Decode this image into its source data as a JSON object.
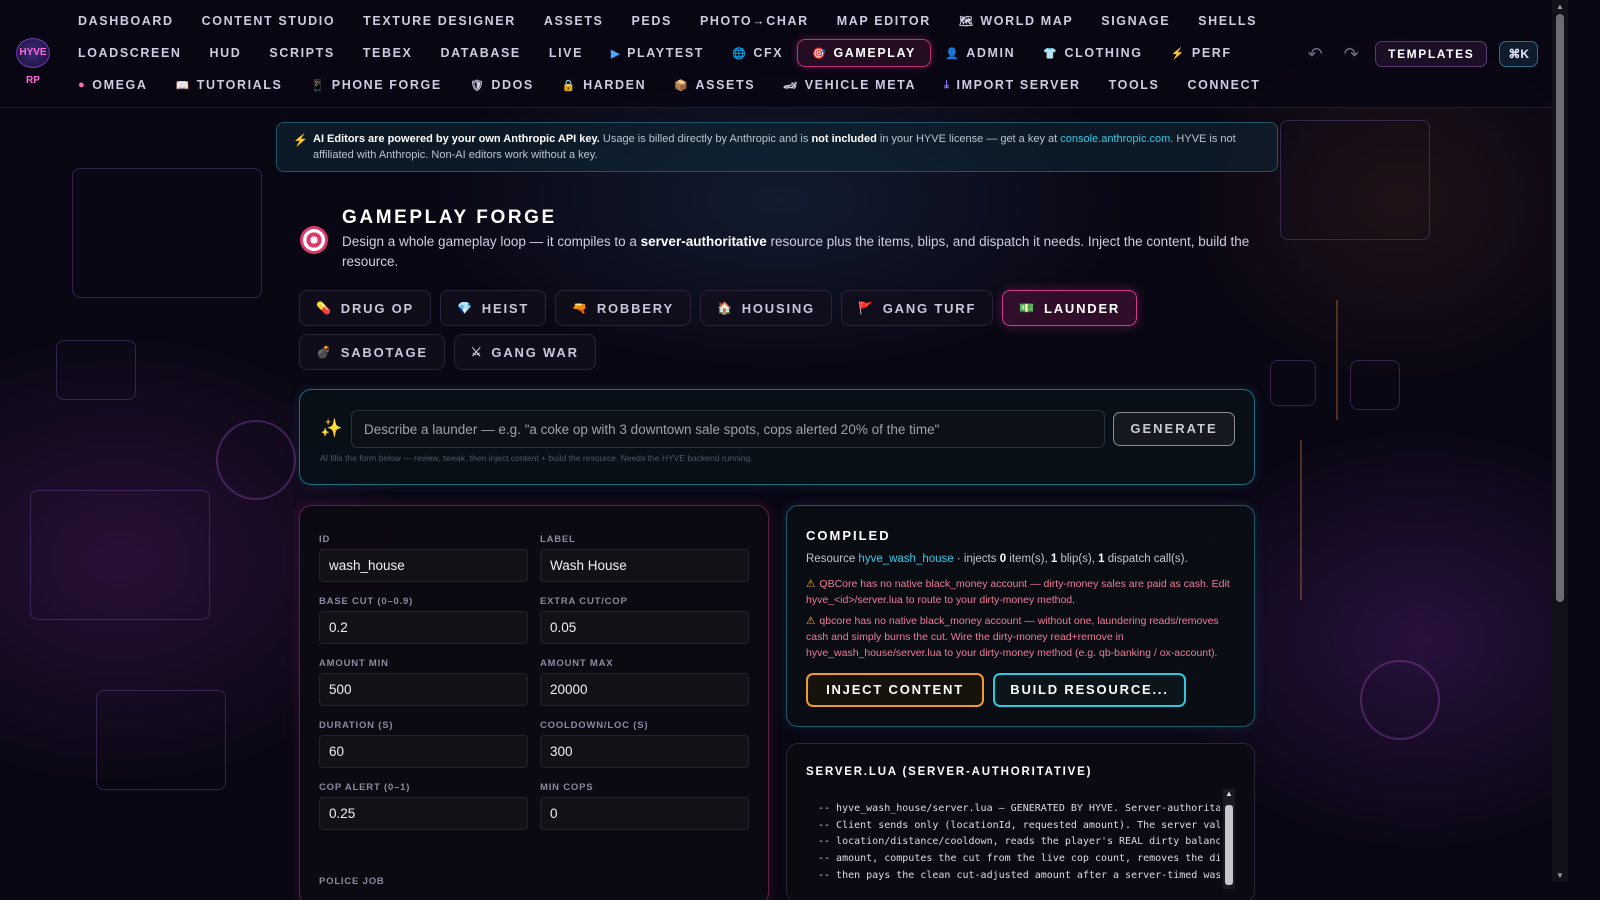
{
  "app": {
    "logo_text": "HYVE RP"
  },
  "nav": {
    "row1": [
      {
        "label": "DASHBOARD",
        "icon": ""
      },
      {
        "label": "CONTENT STUDIO",
        "icon": ""
      },
      {
        "label": "TEXTURE DESIGNER",
        "icon": ""
      },
      {
        "label": "ASSETS",
        "icon": ""
      },
      {
        "label": "PEDS",
        "icon": ""
      },
      {
        "label": "PHOTO→CHAR",
        "icon": ""
      },
      {
        "label": "MAP EDITOR",
        "icon": ""
      },
      {
        "label": "WORLD MAP",
        "icon": "🗺"
      },
      {
        "label": "SIGNAGE",
        "icon": ""
      },
      {
        "label": "SHELLS",
        "icon": ""
      }
    ],
    "row2": [
      {
        "label": "LOADSCREEN",
        "icon": ""
      },
      {
        "label": "HUD",
        "icon": ""
      },
      {
        "label": "SCRIPTS",
        "icon": ""
      },
      {
        "label": "TEBEX",
        "icon": ""
      },
      {
        "label": "DATABASE",
        "icon": ""
      },
      {
        "label": "LIVE",
        "icon": ""
      },
      {
        "label": "PLAYTEST",
        "icon": "▶"
      },
      {
        "label": "CFX",
        "icon": "🌐"
      },
      {
        "label": "GAMEPLAY",
        "icon": "🎯",
        "active": true
      },
      {
        "label": "ADMIN",
        "icon": "👤"
      },
      {
        "label": "CLOTHING",
        "icon": "👕"
      },
      {
        "label": "PERF",
        "icon": "⚡"
      }
    ],
    "row3": [
      {
        "label": "OMEGA",
        "icon": "●"
      },
      {
        "label": "TUTORIALS",
        "icon": "📖"
      },
      {
        "label": "PHONE FORGE",
        "icon": "📱"
      },
      {
        "label": "DDOS",
        "icon": "🛡"
      },
      {
        "label": "HARDEN",
        "icon": "🔒"
      },
      {
        "label": "ASSETS",
        "icon": "📦"
      },
      {
        "label": "VEHICLE META",
        "icon": "🏎"
      },
      {
        "label": "IMPORT SERVER",
        "icon": "⤓"
      },
      {
        "label": "TOOLS",
        "icon": ""
      },
      {
        "label": "CONNECT",
        "icon": ""
      }
    ],
    "undo_icon": "↶",
    "redo_icon": "↷",
    "templates_label": "TEMPLATES",
    "cmdk_label": "⌘K"
  },
  "notice": {
    "bold_lead": "AI Editors are powered by your own Anthropic API key.",
    "text1": " Usage is billed directly by Anthropic and is ",
    "bold_mid": "not included",
    "text2": " in your HYVE license — get a key at ",
    "link": "console.anthropic.com",
    "text3": ". HYVE is not affiliated with Anthropic. Non-AI editors work without a key."
  },
  "header": {
    "title": "GAMEPLAY FORGE",
    "desc_1": "Design a whole gameplay loop — it compiles to a ",
    "desc_bold": "server-authoritative",
    "desc_2": " resource plus the items, blips, and dispatch it needs. Inject the content, build the resource."
  },
  "tabs": [
    {
      "label": "DRUG OP",
      "icon": "💊"
    },
    {
      "label": "HEIST",
      "icon": "💎"
    },
    {
      "label": "ROBBERY",
      "icon": "🔫"
    },
    {
      "label": "HOUSING",
      "icon": "🏠"
    },
    {
      "label": "GANG TURF",
      "icon": "🚩"
    },
    {
      "label": "LAUNDER",
      "icon": "💵",
      "active": true
    },
    {
      "label": "SABOTAGE",
      "icon": "💣"
    },
    {
      "label": "GANG WAR",
      "icon": "⚔"
    }
  ],
  "ai": {
    "icon": "✨",
    "placeholder": "Describe a launder — e.g. \"a coke op with 3 downtown sale spots, cops alerted 20% of the time\"",
    "generate_label": "GENERATE",
    "hint": "AI fills the form below — review, tweak, then inject content + build the resource. Needs the HYVE backend running."
  },
  "form": {
    "fields": [
      {
        "label": "ID",
        "value": "wash_house"
      },
      {
        "label": "LABEL",
        "value": "Wash House"
      },
      {
        "label": "BASE CUT (0–0.9)",
        "value": "0.2"
      },
      {
        "label": "EXTRA CUT/COP",
        "value": "0.05"
      },
      {
        "label": "AMOUNT MIN",
        "value": "500"
      },
      {
        "label": "AMOUNT MAX",
        "value": "20000"
      },
      {
        "label": "DURATION (S)",
        "value": "60"
      },
      {
        "label": "COOLDOWN/LOC (S)",
        "value": "300"
      },
      {
        "label": "COP ALERT (0–1)",
        "value": "0.25"
      },
      {
        "label": "MIN COPS",
        "value": "0"
      }
    ],
    "next_label": "POLICE JOB"
  },
  "compiled": {
    "title": "COMPILED",
    "resource_prefix": "Resource ",
    "resource_name": "hyve_wash_house",
    "injects_text": " · injects ",
    "items_count": "0",
    "items_text": " item(s), ",
    "blips_count": "1",
    "blips_text": " blip(s), ",
    "dispatch_count": "1",
    "dispatch_text": " dispatch call(s).",
    "warnings": [
      "QBCore has no native black_money account — dirty-money sales are paid as cash. Edit hyve_<id>/server.lua to route to your dirty-money method.",
      "qbcore has no native black_money account — without one, laundering reads/removes cash and simply burns the cut. Wire the dirty-money read+remove in hyve_wash_house/server.lua to your dirty-money method (e.g. qb-banking / ox-account)."
    ],
    "inject_label": "INJECT CONTENT",
    "build_label": "BUILD RESOURCE..."
  },
  "server_lua": {
    "title": "SERVER.LUA (SERVER-AUTHORITATIVE)",
    "lines": [
      "-- hyve_wash_house/server.lua — GENERATED BY HYVE. Server-authoritative",
      "-- Client sends only (locationId, requested amount). The server validat",
      "-- location/distance/cooldown, reads the player's REAL dirty balance, c",
      "-- amount, computes the cut from the live cop count, removes the dirty m",
      "-- then pays the clean cut-adjusted amount after a server-timed wash."
    ]
  }
}
